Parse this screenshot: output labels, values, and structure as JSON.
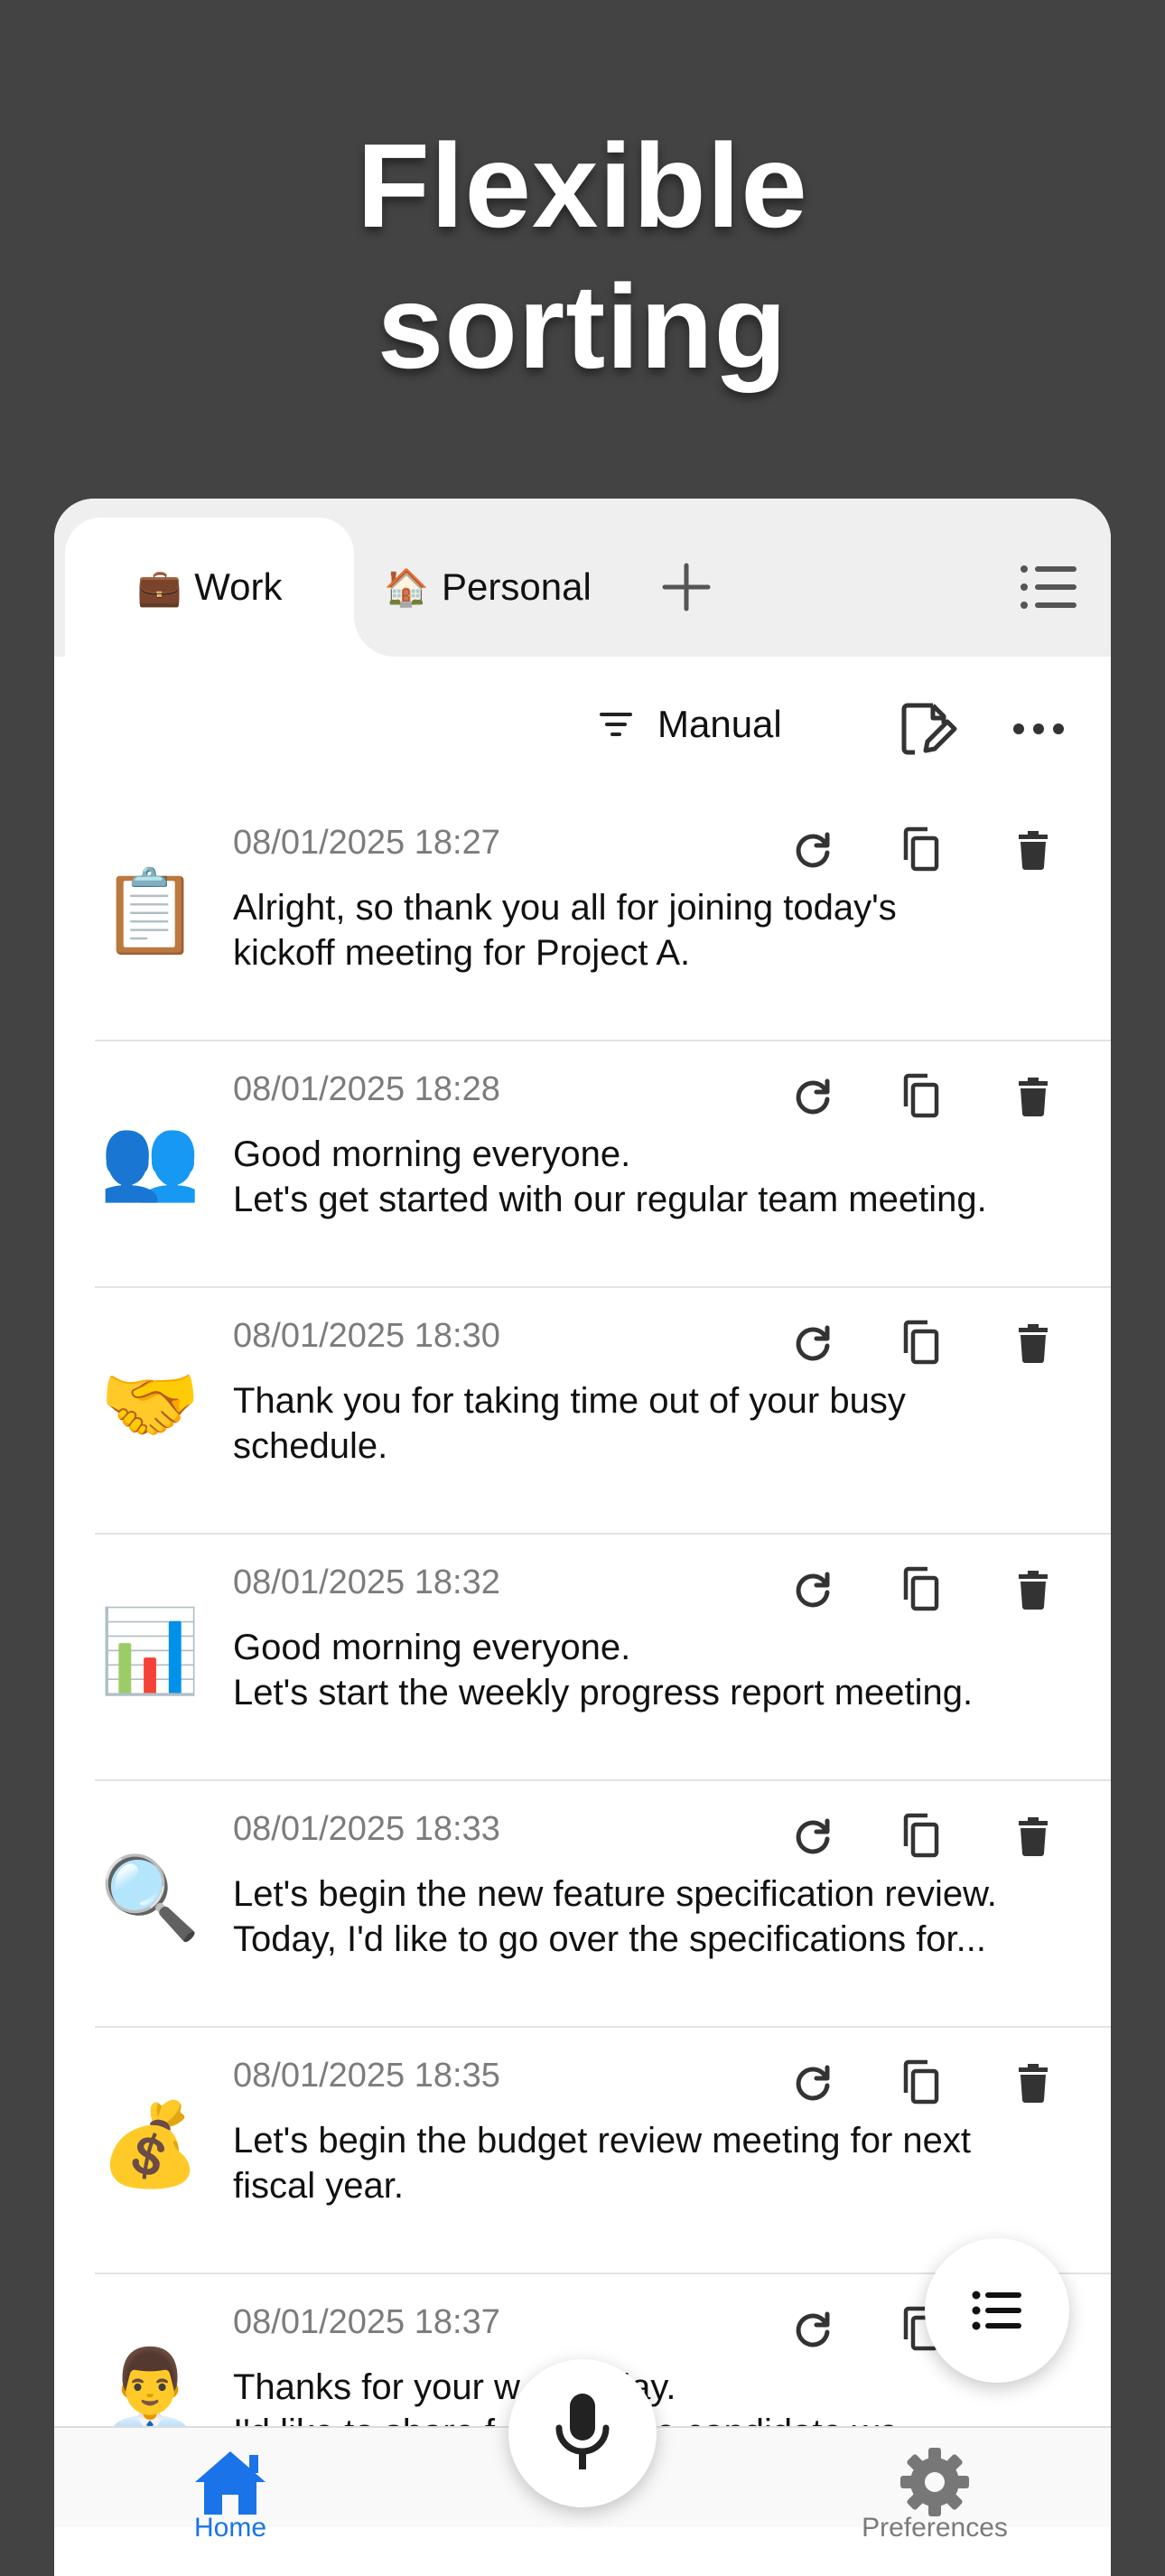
{
  "headline": {
    "line1": "Flexible",
    "line2": "sorting"
  },
  "tabs": [
    {
      "emoji": "💼",
      "label": "Work",
      "active": true
    },
    {
      "emoji": "🏠",
      "label": "Personal",
      "active": false
    }
  ],
  "toolbar": {
    "sort_label": "Manual"
  },
  "notes": [
    {
      "emoji": "📋",
      "timestamp": "08/01/2025 18:27",
      "text": "Alright, so thank you all for joining today's\nkickoff meeting for Project A."
    },
    {
      "emoji": "👥",
      "timestamp": "08/01/2025 18:28",
      "text": "Good morning everyone.\nLet's get started with our regular team meeting."
    },
    {
      "emoji": "🤝",
      "timestamp": "08/01/2025 18:30",
      "text": "Thank you for taking time out of your busy\nschedule."
    },
    {
      "emoji": "📊",
      "timestamp": "08/01/2025 18:32",
      "text": "Good morning everyone.\nLet's start the weekly progress report meeting."
    },
    {
      "emoji": "🔍",
      "timestamp": "08/01/2025 18:33",
      "text": "Let's begin the new feature specification review.\nToday, I'd like to go over the specifications for..."
    },
    {
      "emoji": "💰",
      "timestamp": "08/01/2025 18:35",
      "text": "Let's begin the budget review meeting for next\nfiscal year."
    },
    {
      "emoji": "👨‍💼",
      "timestamp": "08/01/2025 18:37",
      "text": "Thanks for your w         day.\nI'd like to share f        on the candidate we..."
    }
  ],
  "bottom_nav": {
    "home_label": "Home",
    "prefs_label": "Preferences"
  },
  "colors": {
    "background": "#434343",
    "accent": "#1a73e8",
    "tabbar": "#efefef"
  }
}
